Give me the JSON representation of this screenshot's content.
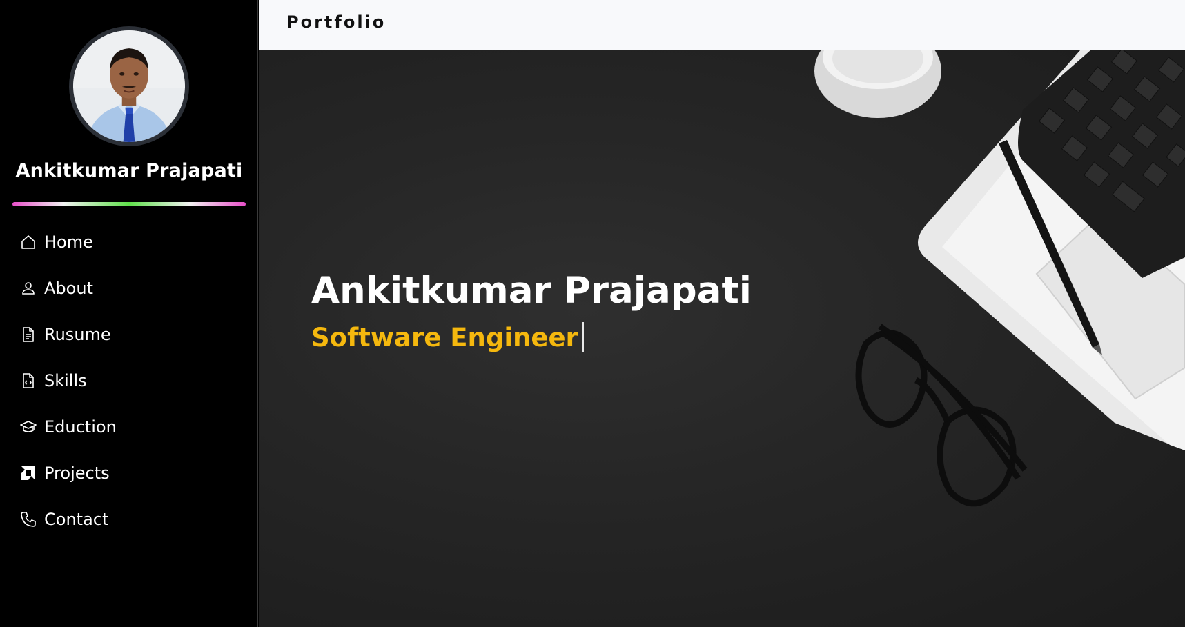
{
  "sidebar": {
    "profile_name": "Ankitkumar Prajapati",
    "avatar_icon": "profile-photo",
    "items": [
      {
        "label": "Home",
        "icon": "house-icon"
      },
      {
        "label": "About",
        "icon": "person-icon"
      },
      {
        "label": "Rusume",
        "icon": "document-icon"
      },
      {
        "label": "Skills",
        "icon": "code-file-icon"
      },
      {
        "label": "Eduction",
        "icon": "graduation-cap-icon"
      },
      {
        "label": "Projects",
        "icon": "amd-logo-icon"
      },
      {
        "label": "Contact",
        "icon": "phone-icon"
      }
    ]
  },
  "header": {
    "brand": "Portfolio"
  },
  "hero": {
    "name": "Ankitkumar Prajapati",
    "role": "Software Engineer"
  },
  "colors": {
    "sidebar_bg": "#000000",
    "topbar_bg": "#f8f9fb",
    "hero_bg": "#262626",
    "role_accent": "#f5b80e",
    "divider_pink": "#e84fc9",
    "divider_green": "#5fe04a"
  }
}
